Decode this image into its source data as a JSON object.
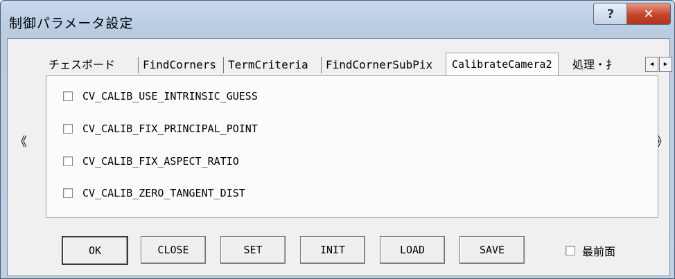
{
  "window": {
    "title": "制御パラメータ設定",
    "help_label": "?",
    "close_label": "✕"
  },
  "nav": {
    "prev_label": "《",
    "next_label": "》"
  },
  "tabs": [
    {
      "label": "チェスボード"
    },
    {
      "label": "FindCorners"
    },
    {
      "label": "TermCriteria"
    },
    {
      "label": "FindCornerSubPix"
    },
    {
      "label": "CalibrateCamera2"
    },
    {
      "label": "処理・扌"
    }
  ],
  "active_tab_index": 4,
  "tab_scroll": {
    "left_label": "◀",
    "right_label": "▶"
  },
  "options": [
    {
      "label": "CV_CALIB_USE_INTRINSIC_GUESS",
      "checked": false
    },
    {
      "label": "CV_CALIB_FIX_PRINCIPAL_POINT",
      "checked": false
    },
    {
      "label": "CV_CALIB_FIX_ASPECT_RATIO",
      "checked": false
    },
    {
      "label": "CV_CALIB_ZERO_TANGENT_DIST",
      "checked": false
    }
  ],
  "buttons": {
    "ok": "OK",
    "close": "CLOSE",
    "set": "SET",
    "init": "INIT",
    "load": "LOAD",
    "save": "SAVE"
  },
  "topmost": {
    "label": "最前面",
    "checked": false
  }
}
